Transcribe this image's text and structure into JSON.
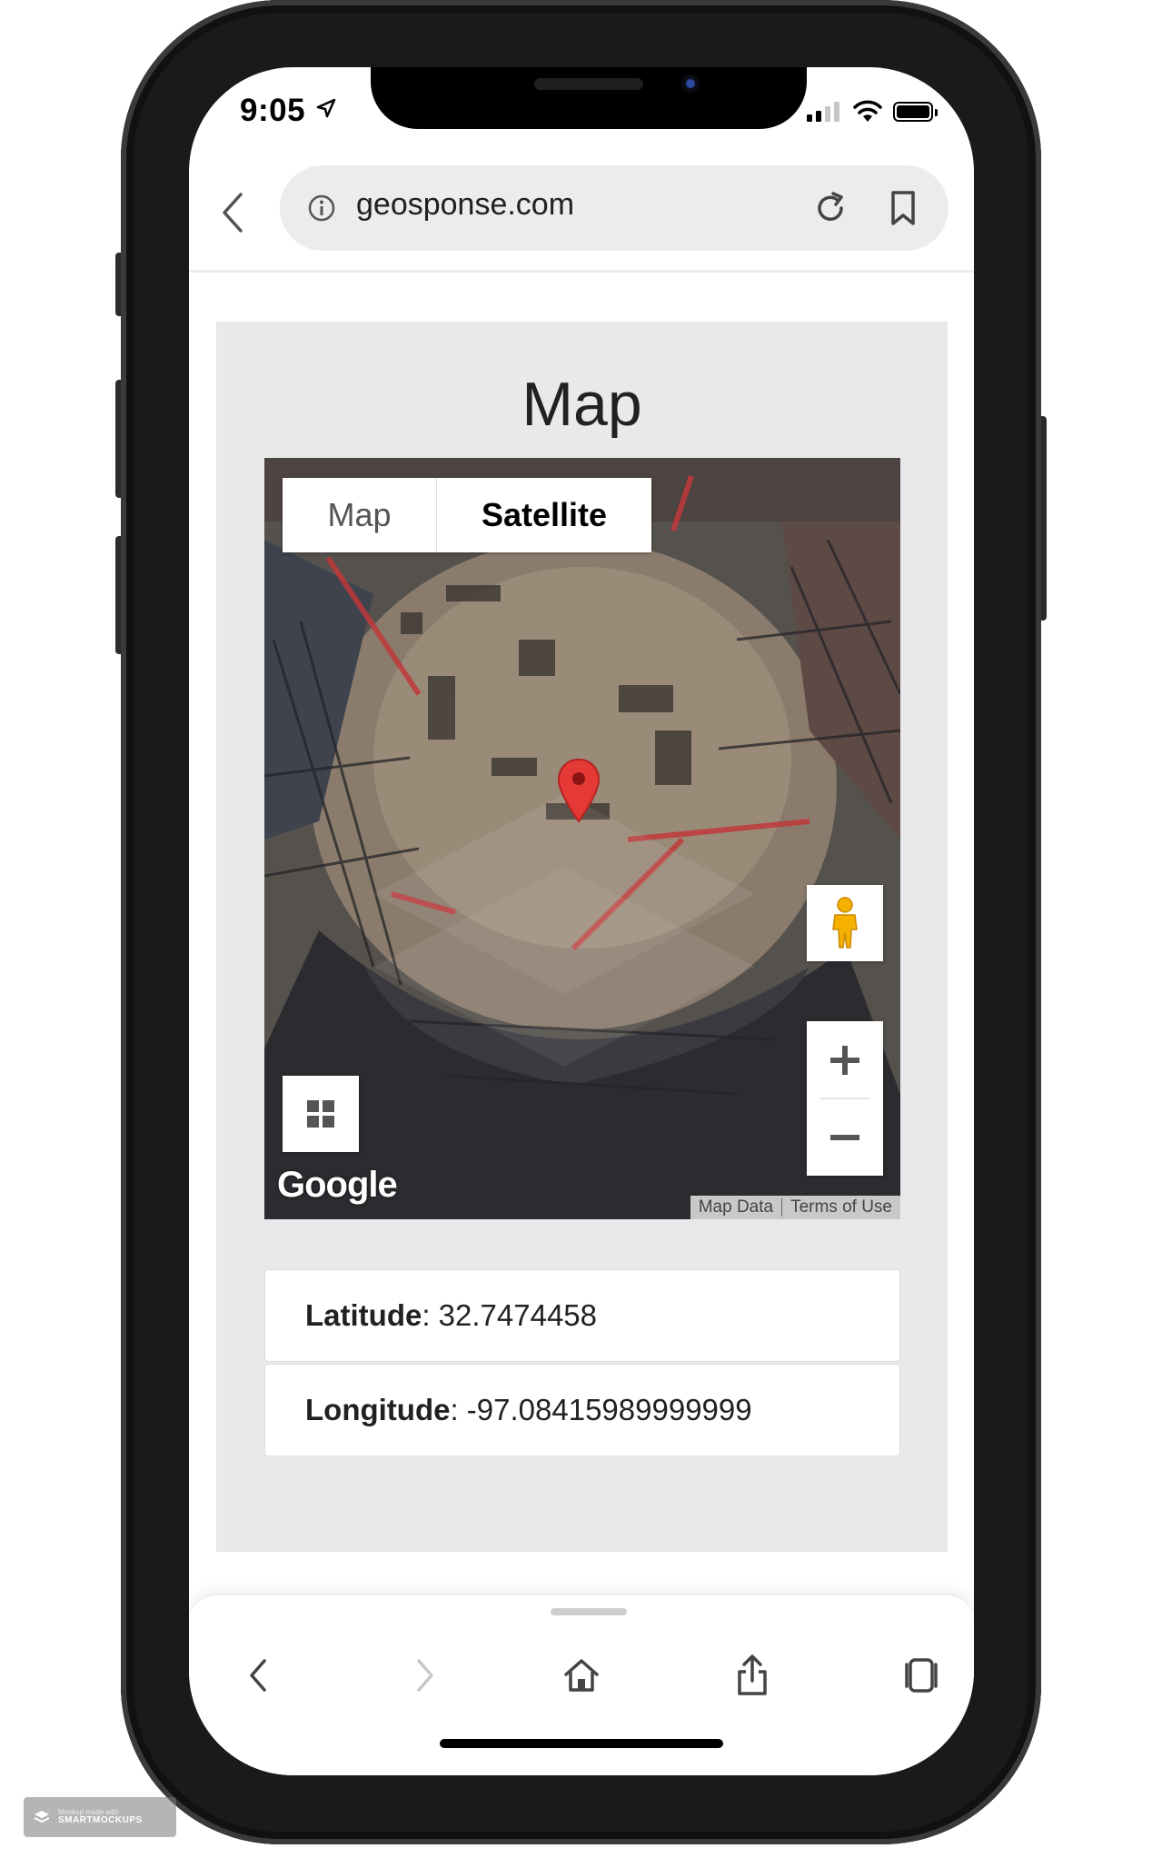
{
  "status_bar": {
    "time": "9:05"
  },
  "browser": {
    "url": "geosponse.com"
  },
  "page": {
    "title": "Map"
  },
  "map": {
    "type_buttons": {
      "map": "Map",
      "satellite": "Satellite"
    },
    "selected_type": "Satellite",
    "logo": "Google",
    "attribution": {
      "map_data": "Map Data",
      "terms": "Terms of Use"
    },
    "zoom_in": "+",
    "zoom_out": "−"
  },
  "coordinates": {
    "latitude_label": "Latitude",
    "latitude_value": ": 32.7474458",
    "longitude_label": "Longitude",
    "longitude_value": ": -97.08415989999999"
  },
  "toolbar": {
    "icons": [
      "back-arrow-icon",
      "forward-arrow-icon",
      "home-icon",
      "share-icon",
      "tabs-icon"
    ]
  },
  "watermark": {
    "line1": "Mockup made with",
    "line2": "SMARTMOCKUPS"
  },
  "colors": {
    "marker": "#e53935",
    "page_bg": "#e9e9ec",
    "url_bar": "#ececec"
  }
}
